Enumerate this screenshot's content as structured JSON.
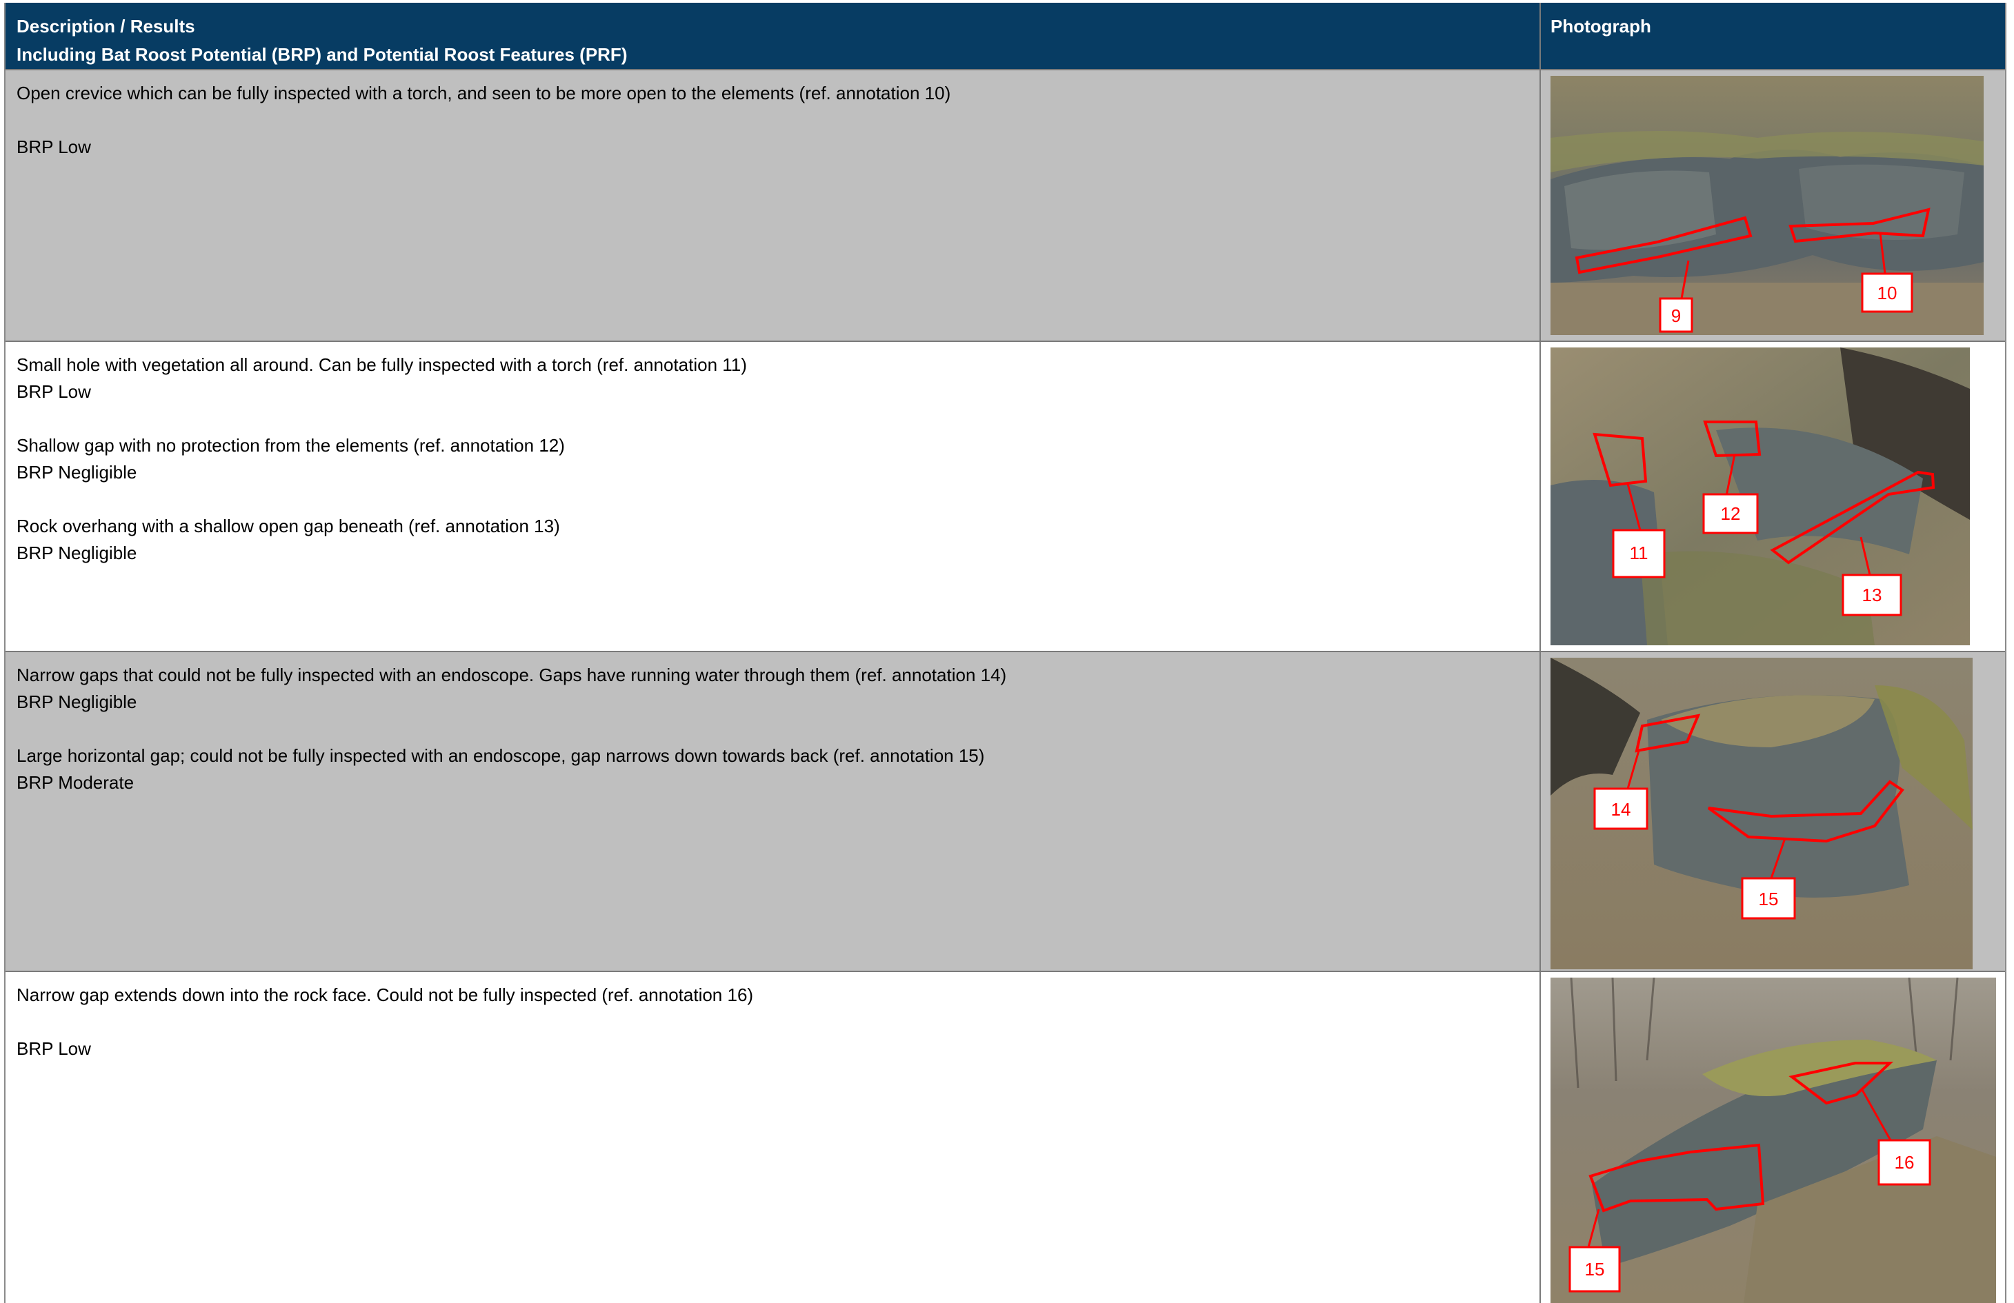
{
  "header": {
    "desc_line1": "Description / Results",
    "desc_line2": "Including Bat Roost Potential (BRP) and Potential Roost Features (PRF)",
    "photo": "Photograph"
  },
  "rows": [
    {
      "lines": [
        "Open crevice which can be fully inspected with a torch, and seen to be more open to the elements (ref. annotation 10)",
        "",
        "BRP Low"
      ],
      "annotations": [
        "9",
        "10"
      ]
    },
    {
      "lines": [
        "Small hole with vegetation all around. Can be fully inspected with a torch (ref. annotation 11)",
        "BRP Low",
        "",
        "Shallow gap with no protection from the elements (ref. annotation 12)",
        "BRP Negligible",
        "",
        "Rock overhang with a shallow open gap beneath (ref. annotation 13)",
        "BRP Negligible"
      ],
      "annotations": [
        "11",
        "12",
        "13"
      ]
    },
    {
      "lines": [
        "Narrow gaps that could not be fully inspected with an endoscope. Gaps have running water through them (ref. annotation 14)",
        "BRP Negligible",
        "",
        "Large horizontal gap; could not be fully inspected with an endoscope, gap narrows down towards back (ref. annotation 15)",
        "BRP Moderate"
      ],
      "annotations": [
        "14",
        "15"
      ]
    },
    {
      "lines": [
        "Narrow gap extends down into the rock face. Could not be fully inspected (ref. annotation 16)",
        "",
        "BRP Low"
      ],
      "annotations": [
        "16",
        "15"
      ]
    }
  ],
  "colors": {
    "header_bg": "#073c63",
    "row_grey": "#bfbfbf",
    "annotation": "#ff0000"
  }
}
